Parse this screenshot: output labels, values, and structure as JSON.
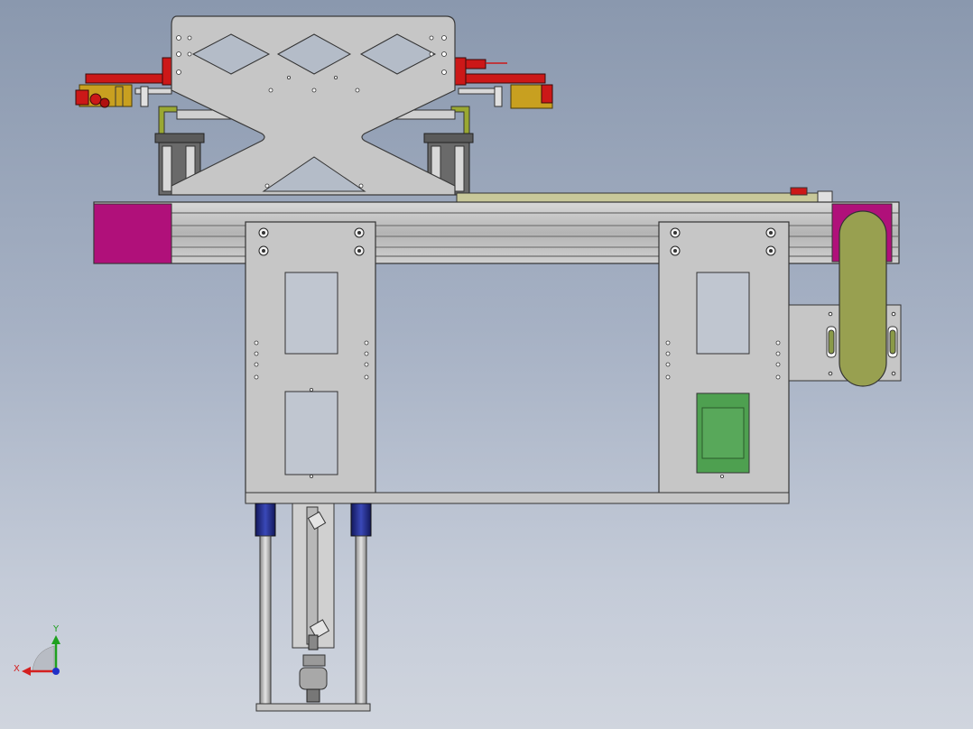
{
  "triad": {
    "x_label": "X",
    "y_label": "Y",
    "x_color": "#d42020",
    "y_color": "#1fa01f",
    "z_color": "#2030c8"
  },
  "colors": {
    "plate": "#c6c6c6",
    "edge": "#3a3a3a",
    "magenta": "#b0107a",
    "red": "#cc1818",
    "olive": "#8a9a48",
    "yellow_ochre": "#c8a020",
    "blue_cylinder": "#1e2880",
    "green_panel": "#4ea050",
    "chain": "#98a050"
  }
}
